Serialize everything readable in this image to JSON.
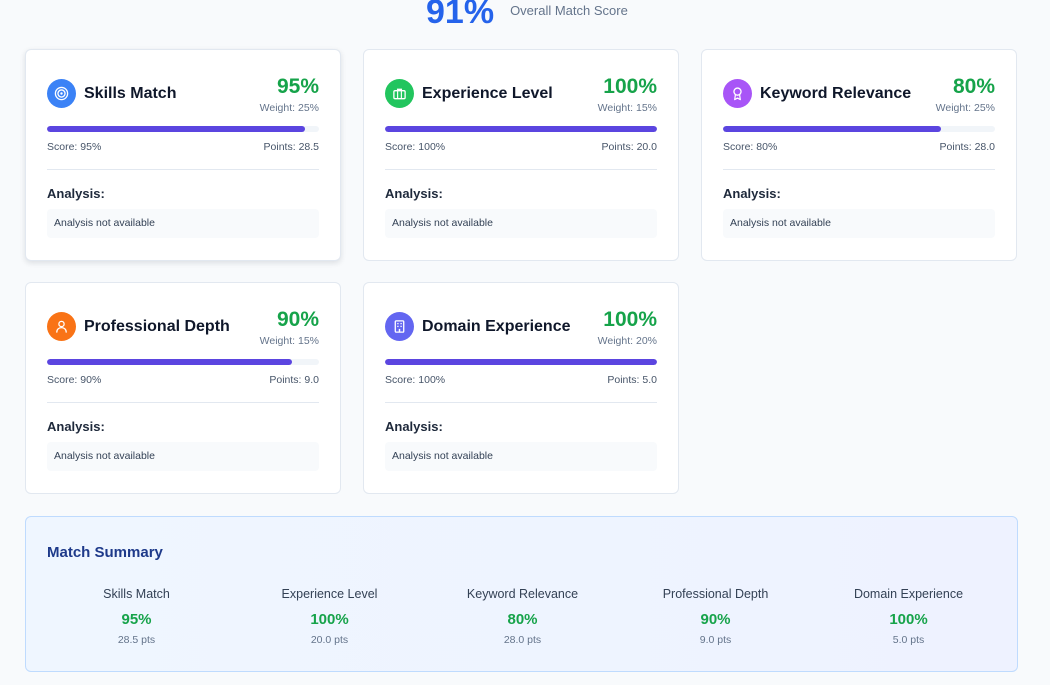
{
  "overall": {
    "score": "91%",
    "label": "Overall Match Score"
  },
  "cards": [
    {
      "title": "Skills Match",
      "score": "95%",
      "weight": "Weight: 25%",
      "fill": 0.95,
      "score_text": "Score: 95%",
      "points_text": "Points: 28.5",
      "analysis_label": "Analysis:",
      "analysis_text": "Analysis not available",
      "icon": "target-icon",
      "icon_color": "#3b82f6"
    },
    {
      "title": "Experience Level",
      "score": "100%",
      "weight": "Weight: 15%",
      "fill": 1.0,
      "score_text": "Score: 100%",
      "points_text": "Points: 20.0",
      "analysis_label": "Analysis:",
      "analysis_text": "Analysis not available",
      "icon": "briefcase-icon",
      "icon_color": "#22c55e"
    },
    {
      "title": "Keyword Relevance",
      "score": "80%",
      "weight": "Weight: 25%",
      "fill": 0.8,
      "score_text": "Score: 80%",
      "points_text": "Points: 28.0",
      "analysis_label": "Analysis:",
      "analysis_text": "Analysis not available",
      "icon": "award-icon",
      "icon_color": "#a855f7"
    },
    {
      "title": "Professional Depth",
      "score": "90%",
      "weight": "Weight: 15%",
      "fill": 0.9,
      "score_text": "Score: 90%",
      "points_text": "Points: 9.0",
      "analysis_label": "Analysis:",
      "analysis_text": "Analysis not available",
      "icon": "user-icon",
      "icon_color": "#f97316"
    },
    {
      "title": "Domain Experience",
      "score": "100%",
      "weight": "Weight: 20%",
      "fill": 1.0,
      "score_text": "Score: 100%",
      "points_text": "Points: 5.0",
      "analysis_label": "Analysis:",
      "analysis_text": "Analysis not available",
      "icon": "building-icon",
      "icon_color": "#6366f1"
    }
  ],
  "summary": {
    "title": "Match Summary",
    "items": [
      {
        "label": "Skills Match",
        "score": "95%",
        "points": "28.5 pts"
      },
      {
        "label": "Experience Level",
        "score": "100%",
        "points": "20.0 pts"
      },
      {
        "label": "Keyword Relevance",
        "score": "80%",
        "points": "28.0 pts"
      },
      {
        "label": "Professional Depth",
        "score": "90%",
        "points": "9.0 pts"
      },
      {
        "label": "Domain Experience",
        "score": "100%",
        "points": "5.0 pts"
      }
    ]
  },
  "colors": {
    "accent": "#2563eb",
    "bar": "#5b45e0",
    "score_green": "#16a34a"
  }
}
